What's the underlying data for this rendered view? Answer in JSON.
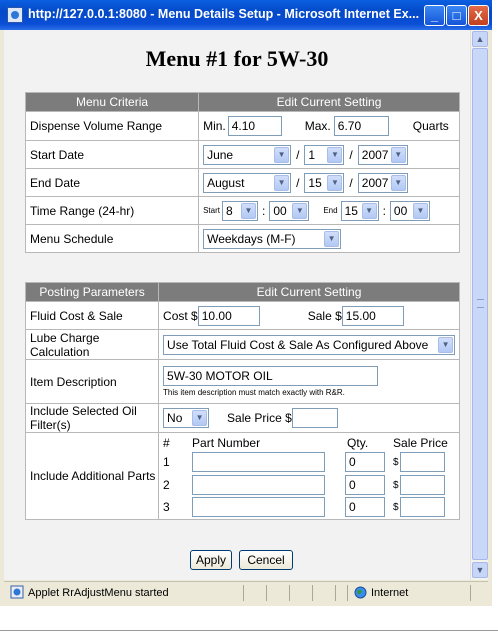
{
  "window": {
    "title": "http://127.0.0.1:8080 - Menu Details Setup - Microsoft Internet Ex...",
    "minimize": "_",
    "maximize": "□",
    "close": "X"
  },
  "page": {
    "title": "Menu #1 for 5W-30"
  },
  "menu_criteria": {
    "col1": "Menu Criteria",
    "col2": "Edit Current Setting",
    "dispense": {
      "label": "Dispense Volume Range",
      "min_label": "Min.",
      "min_value": "4.10",
      "max_label": "Max.",
      "max_value": "6.70",
      "unit": "Quarts"
    },
    "start_date": {
      "label": "Start Date",
      "month": "June",
      "day": "1",
      "year": "2007",
      "sep": "/"
    },
    "end_date": {
      "label": "End Date",
      "month": "August",
      "day": "15",
      "year": "2007",
      "sep": "/"
    },
    "time_range": {
      "label": "Time Range (24-hr)",
      "start_label": "Start",
      "start_hour": "8",
      "start_min": "00",
      "end_label": "End",
      "end_hour": "15",
      "end_min": "00",
      "sep": ":"
    },
    "schedule": {
      "label": "Menu Schedule",
      "value": "Weekdays (M-F)"
    }
  },
  "posting": {
    "col1": "Posting Parameters",
    "col2": "Edit Current Setting",
    "fluid": {
      "label": "Fluid Cost & Sale",
      "cost_label": "Cost $",
      "cost_value": "10.00",
      "sale_label": "Sale $",
      "sale_value": "15.00"
    },
    "lube": {
      "label": "Lube Charge Calculation",
      "value": "Use Total Fluid Cost & Sale As Configured Above"
    },
    "item": {
      "label": "Item Description",
      "value": "5W-30 MOTOR OIL",
      "note": "This item description must match exactly with R&R."
    },
    "oil_filter": {
      "label": "Include Selected Oil Filter(s)",
      "value": "No",
      "price_label": "Sale Price $",
      "price_value": ""
    },
    "parts": {
      "label": "Include Additional Parts",
      "headers": {
        "num": "#",
        "part": "Part Number",
        "qty": "Qty.",
        "price": "Sale Price"
      },
      "currency": "$",
      "rows": [
        {
          "num": "1",
          "part": "",
          "qty": "0",
          "price": ""
        },
        {
          "num": "2",
          "part": "",
          "qty": "0",
          "price": ""
        },
        {
          "num": "3",
          "part": "",
          "qty": "0",
          "price": ""
        }
      ]
    }
  },
  "buttons": {
    "apply": "Apply",
    "cancel": "Cencel"
  },
  "status": {
    "text": "Applet RrAdjustMenu started",
    "zone": "Internet"
  },
  "icons": {
    "scroll_up": "▲",
    "scroll_down": "▼",
    "dropdown": "▼"
  }
}
